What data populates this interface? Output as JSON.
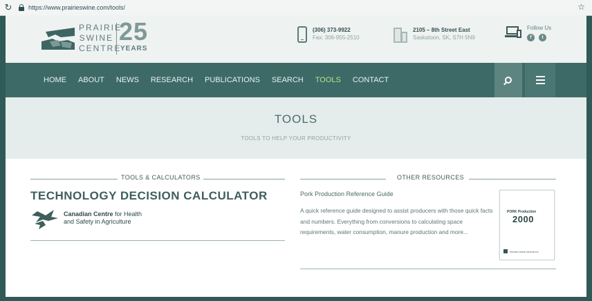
{
  "browser": {
    "url": "https://www.prairieswine.com/tools/"
  },
  "logo": {
    "line1": "PRAIRIE",
    "line2": "SWINE",
    "line3": "CENTRE",
    "anniversary_number": "25",
    "anniversary_word": "YEARS"
  },
  "contact": {
    "phone": "(306) 373-9922",
    "fax": "Fax: 306-955-2510",
    "address_line1": "2105 – 8th Street East",
    "address_line2": "Saskatoon, SK, S7H 5N9",
    "follow_label": "Follow Us"
  },
  "nav": {
    "items": [
      "HOME",
      "ABOUT",
      "NEWS",
      "RESEARCH",
      "PUBLICATIONS",
      "SEARCH",
      "TOOLS",
      "CONTACT"
    ],
    "active": "TOOLS"
  },
  "hero": {
    "title": "TOOLS",
    "subtitle": "TOOLS TO HELP YOUR PRODUCTIVITY"
  },
  "left_section": {
    "heading": "TOOLS & CALCULATORS",
    "title": "TECHNOLOGY DECISION CALCULATOR",
    "org_bold": "Canadian Centre",
    "org_rest": " for Health",
    "org_line2": "and Safety in Agriculture"
  },
  "right_section": {
    "heading": "OTHER RESOURCES",
    "item_title": "Pork Production Reference Guide",
    "item_desc": "A quick reference guide designed to assist producers with those quick facts and numbers.  Everything from conversions to calculating  space requirements, water consumption, manure production and more...",
    "thumb_title": "PORK Production",
    "thumb_year": "2000",
    "thumb_publisher": "PRAIRIE SWINE CENTRE INC."
  },
  "colors": {
    "nav_bg": "#3d6a67",
    "active_nav": "#b7e08a",
    "hero_bg": "#e4edec",
    "frame": "#2f5a57"
  }
}
